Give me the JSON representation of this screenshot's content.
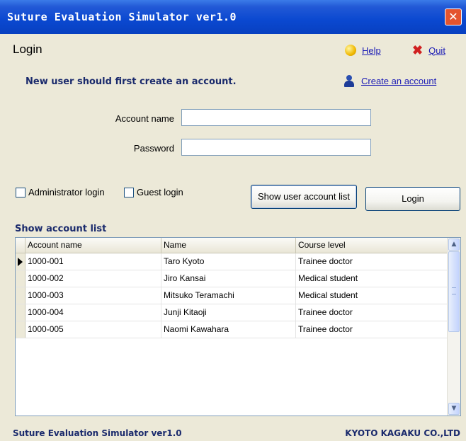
{
  "window": {
    "title": "Suture Evaluation Simulator ver1.0",
    "close_glyph": "✕"
  },
  "header": {
    "title": "Login",
    "help_label": "Help",
    "quit_label": "Quit"
  },
  "notice": {
    "text": "New user should first create an account.",
    "create_link": "Create an account"
  },
  "form": {
    "account_label": "Account name",
    "account_value": "",
    "password_label": "Password",
    "password_value": ""
  },
  "options": {
    "admin_label": "Administrator login",
    "admin_checked": false,
    "guest_label": "Guest login",
    "guest_checked": false
  },
  "buttons": {
    "show_list": "Show user account list",
    "login": "Login"
  },
  "account_list": {
    "title": "Show account list",
    "columns": [
      "Account name",
      "Name",
      "Course level"
    ],
    "rows": [
      {
        "account": "1000-001",
        "name": "Taro Kyoto",
        "course": "Trainee doctor"
      },
      {
        "account": "1000-002",
        "name": "Jiro Kansai",
        "course": "Medical student"
      },
      {
        "account": "1000-003",
        "name": "Mitsuko Teramachi",
        "course": "Medical student"
      },
      {
        "account": "1000-004",
        "name": "Junji Kitaoji",
        "course": "Trainee doctor"
      },
      {
        "account": "1000-005",
        "name": "Naomi Kawahara",
        "course": "Trainee doctor"
      }
    ],
    "selected_row": 0
  },
  "icons": {
    "help": "help-icon",
    "quit": "quit-icon",
    "user": "user-icon"
  },
  "footer": {
    "left": "Suture Evaluation Simulator ver1.0",
    "right": "KYOTO KAGAKU CO.,LTD"
  },
  "colors": {
    "titlebar": "#0a48d0",
    "accent_text": "#1a2a6c",
    "link": "#1b1bb5",
    "window_bg": "#ece9d8"
  }
}
